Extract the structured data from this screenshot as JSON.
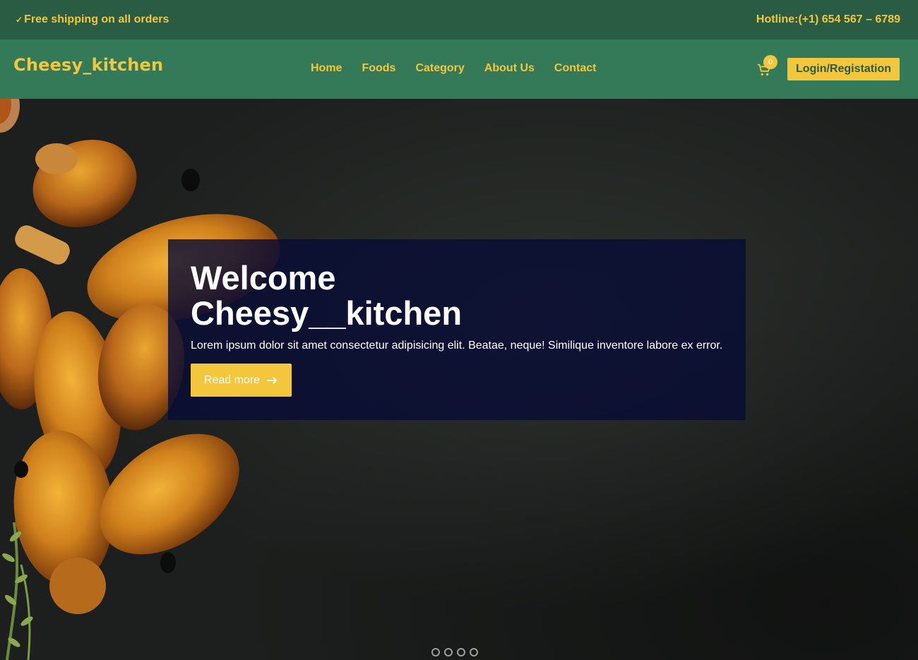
{
  "topbar": {
    "check_icon": "checkmark-icon",
    "shipping": "Free shipping on all orders",
    "hotline": "Hotline:(+1) 654 567 – 6789"
  },
  "navbar": {
    "brand": "Cheesy_kitchen",
    "links": [
      "Home",
      "Foods",
      "Category",
      "About Us",
      "Contact"
    ],
    "cart_icon": "shopping-cart-icon",
    "cart_count": "0",
    "login_label": "Login/Registation"
  },
  "hero": {
    "title_line1": "Welcome",
    "title_line2": "Cheesy__kitchen",
    "text": "Lorem ipsum dolor sit amet consectetur adipisicing elit. Beatae, neque! Similique inventore labore ex error.",
    "read_more": "Read more",
    "read_more_icon": "arrow-right-icon",
    "slides": 4
  },
  "colors": {
    "accent": "#f3c63c",
    "topbar_bg": "#2a5c43",
    "navbar_bg": "#357a58",
    "overlay_bg": "#080c34"
  }
}
